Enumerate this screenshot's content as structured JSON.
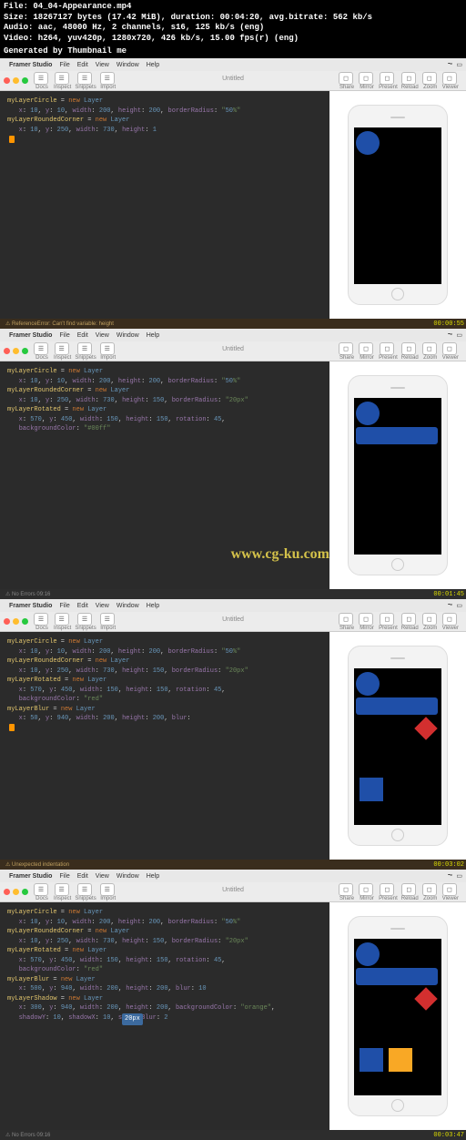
{
  "header": {
    "file": "File: 04_04-Appearance.mp4",
    "size": "Size: 18267127 bytes (17.42 MiB), duration: 00:04:20, avg.bitrate: 562 kb/s",
    "audio": "Audio: aac, 48000 Hz, 2 channels, s16, 125 kb/s (eng)",
    "video": "Video: h264, yuv420p, 1280x720, 426 kb/s, 15.00 fps(r) (eng)",
    "gen": "Generated by Thumbnail me"
  },
  "menubar": {
    "app": "Framer Studio",
    "items": [
      "File",
      "Edit",
      "View",
      "Window",
      "Help"
    ]
  },
  "toolbar": {
    "title": "Untitled",
    "left": [
      "Docs",
      "Inspect",
      "Snippets",
      "Import"
    ],
    "right": [
      "Share",
      "Mirror",
      "Present",
      "Reload",
      "Zoom",
      "Viewer"
    ]
  },
  "watermark": "www.cg-ku.com",
  "frames": [
    {
      "time": "00:00:55",
      "code": "myLayerCircle = new Layer\n   x: 10, y: 10, width: 200, height: 200, borderRadius: \"50%\"\n\nmyLayerRoundedCorner = new Layer\n   x: 10, y: 250, width: 730, height: 1",
      "status": "ReferenceError: Can't find variable: height",
      "statusOk": false,
      "shapes": [
        "circle"
      ],
      "cursor": true
    },
    {
      "time": "00:01:45",
      "code": "myLayerCircle = new Layer\n   x: 10, y: 10, width: 200, height: 200, borderRadius: \"50%\"\n\nmyLayerRoundedCorner = new Layer\n   x: 10, y: 250, width: 730, height: 150, borderRadius: \"20px\"\n\nmyLayerRotated = new Layer\n   x: 570, y: 450, width: 150, height: 150, rotation: 45,\n   backgroundColor: \"#00ff\"",
      "status": "No Errors 09:16",
      "statusOk": true,
      "shapes": [
        "circle",
        "bar"
      ],
      "watermark": true
    },
    {
      "time": "00:03:02",
      "code": "myLayerCircle = new Layer\n   x: 10, y: 10, width: 200, height: 200, borderRadius: \"50%\"\n\nmyLayerRoundedCorner = new Layer\n   x: 10, y: 250, width: 730, height: 150, borderRadius: \"20px\"\n\nmyLayerRotated = new Layer\n   x: 570, y: 450, width: 150, height: 150, rotation: 45,\n   backgroundColor: \"red\"\n\nmyLayerBlur = new Layer\n   x: 50, y: 940, width: 200, height: 200, blur: ",
      "status": "Unexpected indentation",
      "statusOk": false,
      "shapes": [
        "circle",
        "bar",
        "diamond",
        "square"
      ],
      "cursor": true
    },
    {
      "time": "00:03:47",
      "code": "myLayerCircle = new Layer\n   x: 10, y: 10, width: 200, height: 200, borderRadius: \"50%\"\n\nmyLayerRoundedCorner = new Layer\n   x: 10, y: 250, width: 730, height: 150, borderRadius: \"20px\"\n\nmyLayerRotated = new Layer\n   x: 570, y: 450, width: 150, height: 150, rotation: 45,\n   backgroundColor: \"red\"\n\nmyLayerBlur = new Layer\n   x: 500, y: 940, width: 200, height: 200, blur: 10\n\nmyLayerShadow = new Layer\n   x: 300, y: 940, width: 200, height: 200, backgroundColor: \"orange\",\n   shadowY: 10, shadowX: 10, shadowBlur: 2",
      "status": "No Errors 09:16",
      "statusOk": true,
      "shapes": [
        "circle",
        "bar",
        "diamond",
        "square",
        "orange"
      ],
      "tooltip": "20px"
    }
  ]
}
